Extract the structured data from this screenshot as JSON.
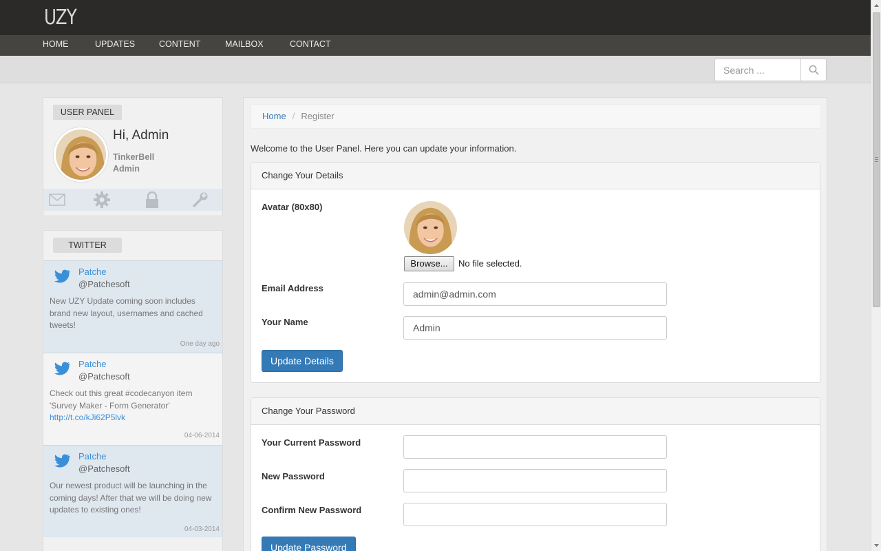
{
  "header": {
    "logo": "UZY",
    "nav": [
      "HOME",
      "UPDATES",
      "CONTENT",
      "MAILBOX",
      "CONTACT"
    ],
    "search_placeholder": "Search ..."
  },
  "user_panel": {
    "tag": "USER PANEL",
    "greeting": "Hi, Admin",
    "username": "TinkerBell",
    "role": "Admin"
  },
  "twitter": {
    "tag": "TWITTER",
    "tweets": [
      {
        "author": "Patche",
        "handle": "@Patchesoft",
        "text": "New UZY Update coming soon includes brand new layout, usernames and cached tweets!",
        "link": "",
        "date": "One day ago"
      },
      {
        "author": "Patche",
        "handle": "@Patchesoft",
        "text": "Check out this great #codecanyon item 'Survey Maker - Form Generator' ",
        "link": "http://t.co/kJi62P5lvk",
        "date": "04-06-2014"
      },
      {
        "author": "Patche",
        "handle": "@Patchesoft",
        "text": "Our newest product will be launching in the coming days! After that we will be doing new updates to existing ones!",
        "link": "",
        "date": "04-03-2014"
      }
    ]
  },
  "breadcrumb": {
    "home": "Home",
    "current": "Register"
  },
  "welcome": "Welcome to the User Panel. Here you can update your information.",
  "details_card": {
    "title": "Change Your Details",
    "avatar_label": "Avatar (80x80)",
    "browse_label": "Browse...",
    "file_status": "No file selected.",
    "email_label": "Email Address",
    "email_value": "admin@admin.com",
    "name_label": "Your Name",
    "name_value": "Admin",
    "submit": "Update Details"
  },
  "password_card": {
    "title": "Change Your Password",
    "current_label": "Your Current Password",
    "new_label": "New Password",
    "confirm_label": "Confirm New Password",
    "submit": "Update Password"
  },
  "colors": {
    "topbar": "#2b2a28",
    "navbar": "#464440",
    "primary": "#337ab7",
    "link": "#3a8fd9"
  }
}
